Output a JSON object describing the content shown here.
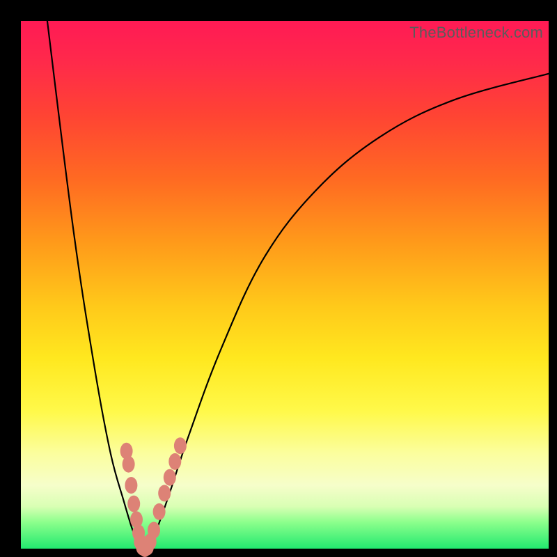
{
  "watermark": "TheBottleneck.com",
  "colors": {
    "bead": "#dd8276",
    "curve": "#000000",
    "frame": "#000000"
  },
  "chart_data": {
    "type": "line",
    "title": "",
    "xlabel": "",
    "ylabel": "",
    "xlim": [
      0,
      100
    ],
    "ylim": [
      0,
      100
    ],
    "grid": false,
    "legend": false,
    "series": [
      {
        "name": "left-branch",
        "x": [
          5,
          10,
          14,
          17,
          19.5,
          21,
          22,
          22.8
        ],
        "y": [
          100,
          60,
          34,
          18,
          9,
          4,
          1.5,
          0
        ]
      },
      {
        "name": "right-branch",
        "x": [
          24.2,
          25.5,
          28,
          32,
          38,
          46,
          56,
          68,
          82,
          100
        ],
        "y": [
          0,
          3,
          10,
          22,
          38,
          55,
          68,
          78,
          85,
          90
        ]
      }
    ],
    "markers": {
      "name": "beads",
      "color": "#dd8276",
      "points_xy": [
        [
          20.0,
          18.5
        ],
        [
          20.4,
          16.0
        ],
        [
          20.9,
          12.0
        ],
        [
          21.4,
          8.5
        ],
        [
          21.9,
          5.5
        ],
        [
          22.3,
          3.0
        ],
        [
          22.6,
          1.3
        ],
        [
          23.0,
          0.3
        ],
        [
          23.5,
          0.0
        ],
        [
          24.0,
          0.3
        ],
        [
          24.5,
          1.3
        ],
        [
          25.2,
          3.5
        ],
        [
          26.2,
          7.0
        ],
        [
          27.2,
          10.5
        ],
        [
          28.2,
          13.5
        ],
        [
          29.2,
          16.5
        ],
        [
          30.2,
          19.5
        ]
      ]
    }
  }
}
